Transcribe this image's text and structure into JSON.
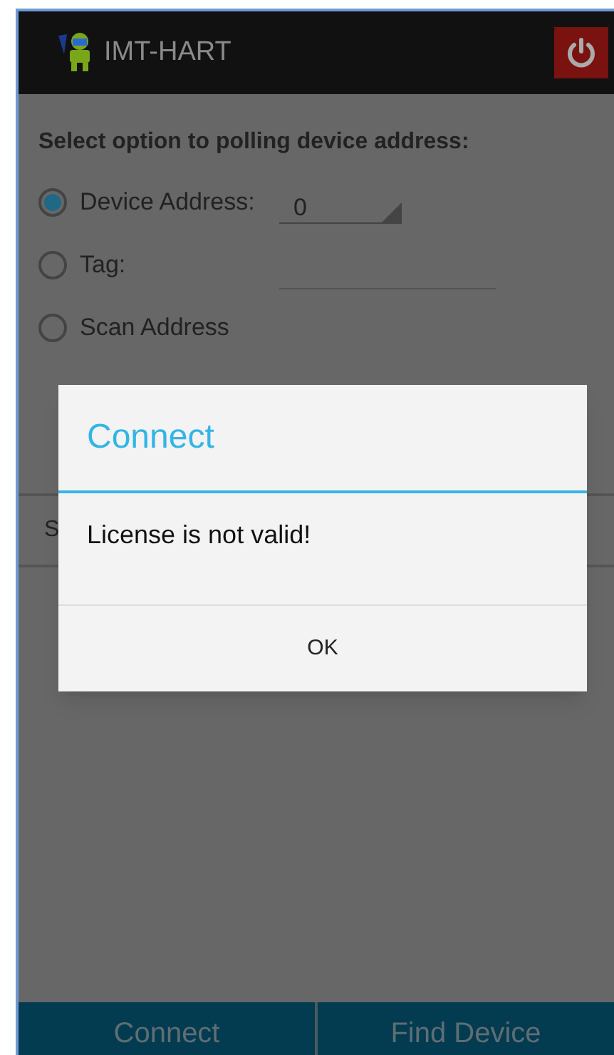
{
  "app_bar": {
    "title": "IMT-HART"
  },
  "prompt": "Select option to polling device address:",
  "options": [
    {
      "label": "Device Address:",
      "selected": true,
      "kind": "dropdown",
      "value": "0"
    },
    {
      "label": "Tag:",
      "selected": false,
      "kind": "field"
    },
    {
      "label": "Scan Address",
      "selected": false,
      "kind": "plain"
    }
  ],
  "section_label": "S",
  "dialog": {
    "title": "Connect",
    "message": "License is not valid!",
    "buttons": [
      "OK"
    ]
  },
  "bottom_buttons": [
    "Connect",
    "Find Device"
  ]
}
